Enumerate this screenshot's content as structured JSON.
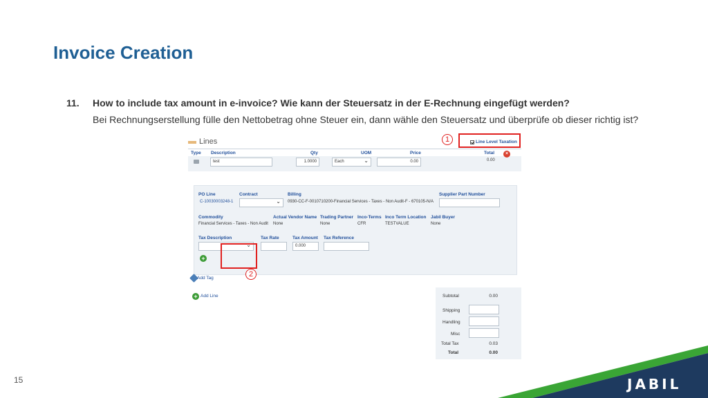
{
  "slide": {
    "title": "Invoice Creation",
    "question_number": "11.",
    "question": "How to include tax amount in e-invoice? Wie kann der Steuersatz in der E-Rechnung eingefügt werden?",
    "description": "Bei Rechnungserstellung fülle den Nettobetrag ohne Steuer ein, dann wähle den Steuersatz und überprüfe ob dieser richtig ist?",
    "page_number": "15",
    "logo_text": "JABIL"
  },
  "colors": {
    "title": "#1f5f94",
    "highlight": "#e0201f",
    "brand_navy": "#1e3a5f",
    "brand_green": "#3aa535"
  },
  "lines_panel": {
    "title": "Lines",
    "line_level_taxation": "Line Level Taxation",
    "columns": {
      "type": "Type",
      "description": "Description",
      "qty": "Qty",
      "uom": "UOM",
      "price": "Price",
      "total": "Total"
    },
    "row": {
      "description": "test",
      "qty": "1.0000",
      "uom": "Each",
      "price": "0.00",
      "total": "0.00"
    },
    "detail": {
      "po_line_label": "PO Line",
      "po_line_value": "C-10030003248-1",
      "contract_label": "Contract",
      "billing_label": "Billing",
      "billing_value": "0930-CC-F-0010710200-Financial Services - Taxes - Non Audit-F - 670105-N/A",
      "supplier_part_label": "Supplier Part Number",
      "commodity_label": "Commodity",
      "commodity_value": "Financial Services - Taxes - Non Audit",
      "actual_vendor_label": "Actual Vendor Name",
      "actual_vendor_value": "None",
      "trading_partner_label": "Trading Partner",
      "trading_partner_value": "None",
      "inco_terms_label": "Inco-Terms",
      "inco_terms_value": "CFR",
      "inco_location_label": "Inco Term Location",
      "inco_location_value": "TESTVALUE",
      "jabil_buyer_label": "Jabil Buyer",
      "jabil_buyer_value": "None",
      "tax_description_label": "Tax Description",
      "tax_rate_label": "Tax Rate",
      "tax_amount_label": "Tax Amount",
      "tax_amount_value": "0.000",
      "tax_reference_label": "Tax Reference"
    },
    "add_tag": "Add Tag",
    "add_line": "Add Line"
  },
  "summary": {
    "subtotal_label": "Subtotal",
    "subtotal_value": "0.00",
    "shipping_label": "Shipping",
    "handling_label": "Handling",
    "misc_label": "Misc",
    "total_tax_label": "Total Tax",
    "total_tax_value": "0.03",
    "total_label": "Total",
    "total_value": "0.00"
  },
  "annotations": {
    "step1": "1",
    "step2": "2"
  }
}
